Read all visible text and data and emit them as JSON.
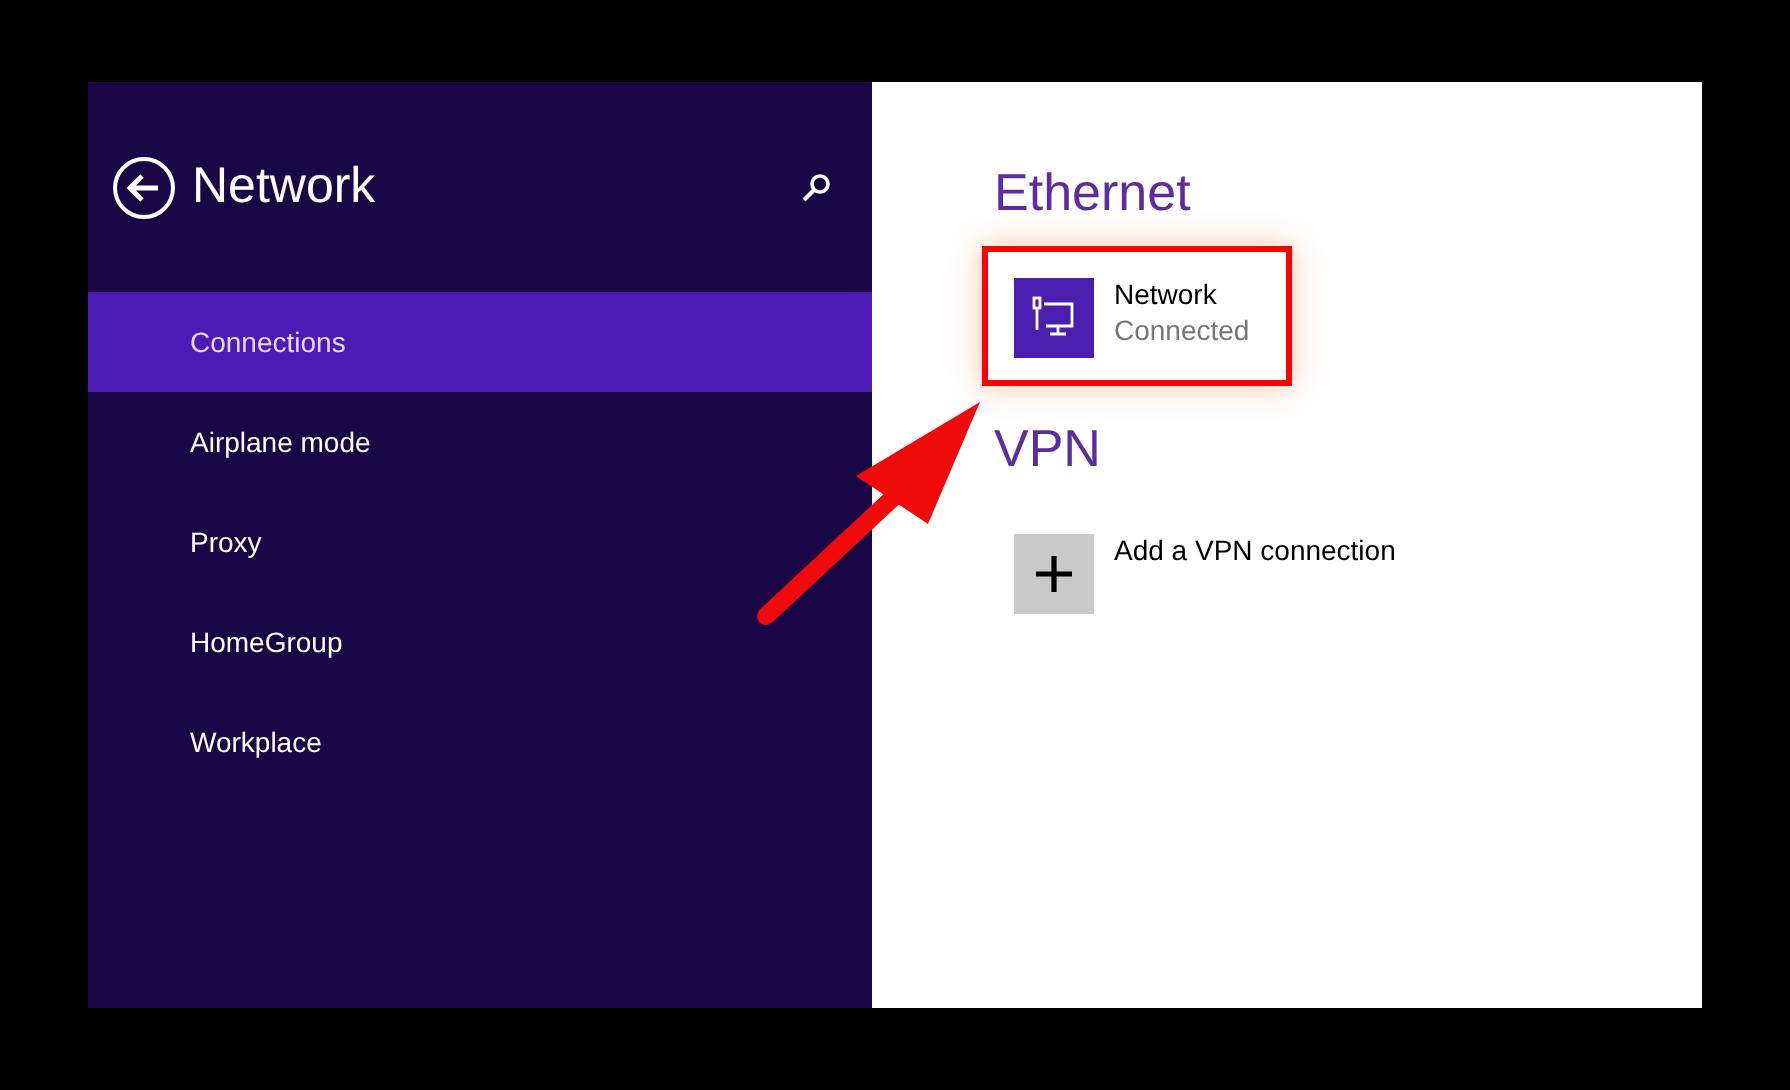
{
  "sidebar": {
    "title": "Network",
    "items": [
      {
        "label": "Connections",
        "selected": true
      },
      {
        "label": "Airplane mode",
        "selected": false
      },
      {
        "label": "Proxy",
        "selected": false
      },
      {
        "label": "HomeGroup",
        "selected": false
      },
      {
        "label": "Workplace",
        "selected": false
      }
    ]
  },
  "sections": [
    {
      "heading": "Ethernet",
      "items": [
        {
          "kind": "connection",
          "name": "Network",
          "status": "Connected",
          "highlighted": true
        }
      ]
    },
    {
      "heading": "VPN",
      "items": [
        {
          "kind": "add",
          "name": "Add a VPN connection",
          "highlighted": false
        }
      ]
    }
  ]
}
